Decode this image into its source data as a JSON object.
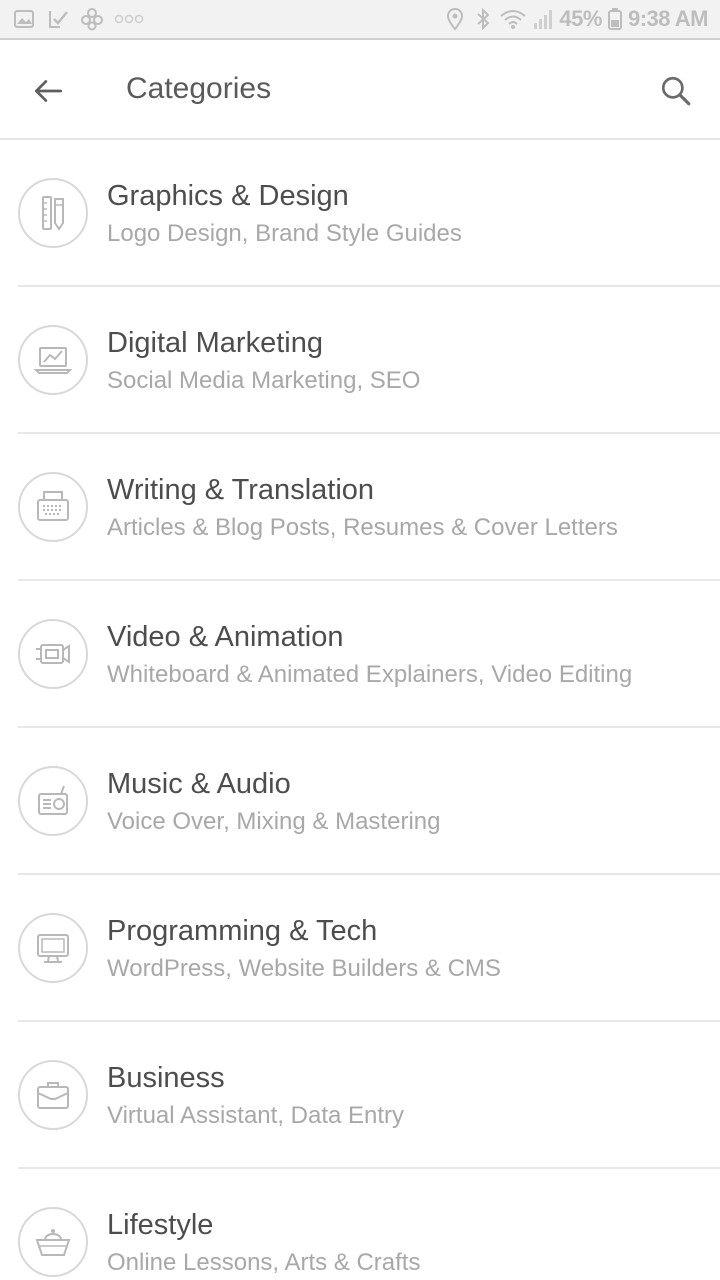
{
  "status_bar": {
    "battery": "45%",
    "time": "9:38 AM",
    "left_icons": [
      "gallery-notification-icon",
      "checklist-notification-icon",
      "flower-app-icon",
      "more-dots-icon"
    ],
    "right_icons": [
      "location-icon",
      "bluetooth-icon",
      "wifi-icon",
      "signal-icon",
      "battery-icon"
    ]
  },
  "app_bar": {
    "title": "Categories",
    "back_icon": "arrow-left-icon",
    "search_icon": "search-icon"
  },
  "categories": [
    {
      "title": "Graphics & Design",
      "subtitle": "Logo Design, Brand Style Guides",
      "icon": "pencil-ruler-icon"
    },
    {
      "title": "Digital Marketing",
      "subtitle": "Social Media Marketing, SEO",
      "icon": "laptop-chart-icon"
    },
    {
      "title": "Writing & Translation",
      "subtitle": "Articles & Blog Posts, Resumes & Cover Letters",
      "icon": "typewriter-icon"
    },
    {
      "title": "Video & Animation",
      "subtitle": "Whiteboard & Animated Explainers, Video Editing",
      "icon": "video-camera-icon"
    },
    {
      "title": "Music & Audio",
      "subtitle": "Voice Over, Mixing & Mastering",
      "icon": "radio-icon"
    },
    {
      "title": "Programming & Tech",
      "subtitle": "WordPress, Website Builders & CMS",
      "icon": "monitor-icon"
    },
    {
      "title": "Business",
      "subtitle": "Virtual Assistant, Data Entry",
      "icon": "briefcase-icon"
    },
    {
      "title": "Lifestyle",
      "subtitle": "Online Lessons, Arts & Crafts",
      "icon": "basket-icon"
    }
  ]
}
